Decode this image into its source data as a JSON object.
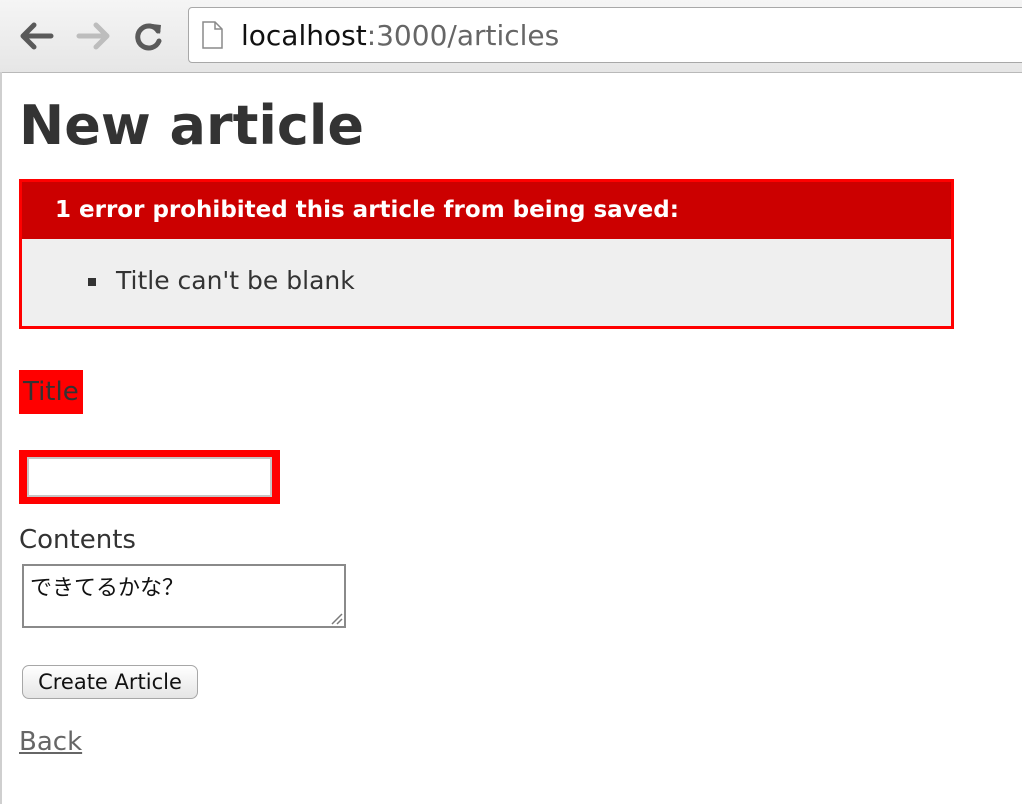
{
  "browser": {
    "url_host": "localhost",
    "url_path": ":3000/articles"
  },
  "page": {
    "title": "New article",
    "errors": {
      "header": "1 error prohibited this article from being saved:",
      "items": [
        "Title can't be blank"
      ]
    },
    "form": {
      "title_label": "Title",
      "title_value": "",
      "contents_label": "Contents",
      "contents_value": "できてるかな？",
      "submit_label": "Create Article"
    },
    "back_link": "Back"
  },
  "colors": {
    "error_red": "#ff0000",
    "error_header": "#cc0000",
    "error_body_bg": "#efefef",
    "text": "#333333"
  }
}
